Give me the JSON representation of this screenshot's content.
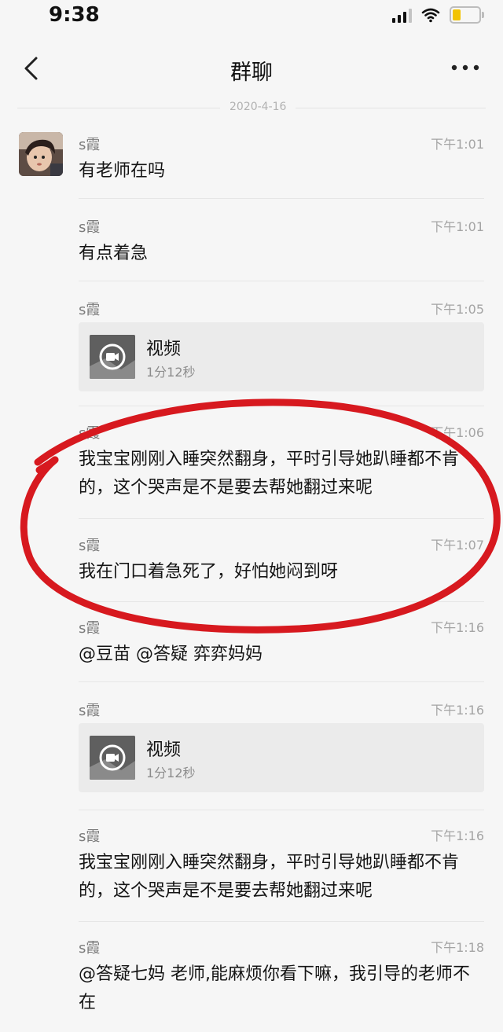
{
  "status_bar": {
    "time": "9:38"
  },
  "navbar": {
    "title": "群聊"
  },
  "date_divider": "2020-4-16",
  "messages": [
    {
      "sender": "s霞",
      "time": "下午1:01",
      "text": "有老师在吗"
    },
    {
      "sender": "s霞",
      "time": "下午1:01",
      "text": "有点着急"
    },
    {
      "sender": "s霞",
      "time": "下午1:05",
      "video": {
        "title": "视频",
        "duration": "1分12秒"
      }
    },
    {
      "sender": "s霞",
      "time": "下午1:06",
      "text": "我宝宝刚刚入睡突然翻身，平时引导她趴睡都不肯的，这个哭声是不是要去帮她翻过来呢"
    },
    {
      "sender": "s霞",
      "time": "下午1:07",
      "text": "我在门口着急死了，好怕她闷到呀"
    },
    {
      "sender": "s霞",
      "time": "下午1:16",
      "text": "@豆苗 @答疑 弈弈妈妈"
    },
    {
      "sender": "s霞",
      "time": "下午1:16",
      "video": {
        "title": "视频",
        "duration": "1分12秒"
      }
    },
    {
      "sender": "s霞",
      "time": "下午1:16",
      "text": "我宝宝刚刚入睡突然翻身，平时引导她趴睡都不肯的，这个哭声是不是要去帮她翻过来呢"
    },
    {
      "sender": "s霞",
      "time": "下午1:18",
      "text": "@答疑七妈 老师,能麻烦你看下嘛，我引导的老师不在"
    }
  ],
  "colors": {
    "annotation": "#d7191f",
    "battery": "#f2c300",
    "background": "#f6f6f6"
  },
  "icons": [
    "back-chevron-icon",
    "more-dots-icon",
    "signal-icon",
    "wifi-icon",
    "battery-icon",
    "video-camera-icon"
  ]
}
